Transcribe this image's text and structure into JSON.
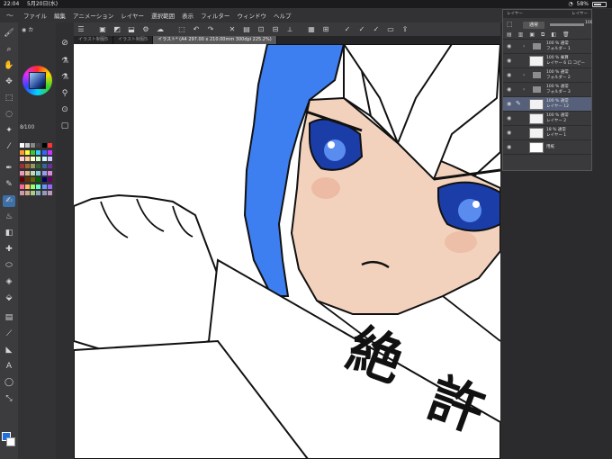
{
  "status": {
    "time": "22:04",
    "date": "5月20日(水)",
    "battery": "58%"
  },
  "menu": [
    "ファイル",
    "編集",
    "アニメーション",
    "レイヤー",
    "選択範囲",
    "表示",
    "フィルター",
    "ウィンドウ",
    "ヘルプ"
  ],
  "tabs": [
    "イラスト制服5",
    "イラスト制服5",
    "イラスト* (A4 297.00 x 210.00mm 300dpi 225.2%)"
  ],
  "brush": {
    "size_label": "8",
    "opacity_label": "100"
  },
  "canvas": {
    "kanji": [
      "絶",
      "許"
    ]
  },
  "layer_panel": {
    "header_left": "レイヤー",
    "header_right": "レイヤー",
    "blend_mode": "通常",
    "opacity": "100",
    "layers": [
      {
        "pct": "100 % 通常",
        "name": "フォルダー 1",
        "kind": "folder"
      },
      {
        "pct": "100 % 乗算",
        "name": "レイヤー 6 ロ コピー",
        "kind": "layer"
      },
      {
        "pct": "100 % 通常",
        "name": "フォルダー 2",
        "kind": "folder"
      },
      {
        "pct": "100 % 通常",
        "name": "フォルダー 3",
        "kind": "folder"
      },
      {
        "pct": "100 % 通常",
        "name": "レイヤー 12",
        "kind": "layer",
        "selected": true
      },
      {
        "pct": "100 % 通常",
        "name": "レイヤー 2",
        "kind": "layer"
      },
      {
        "pct": "18 % 通常",
        "name": "レイヤー 1",
        "kind": "layer"
      },
      {
        "pct": "",
        "name": "用紙",
        "kind": "paper"
      }
    ]
  },
  "colors": {
    "accent": "#3d6fa8",
    "hair": "#3d7ff0",
    "skin": "#f3d2bd",
    "eye": "#1b3da8"
  }
}
